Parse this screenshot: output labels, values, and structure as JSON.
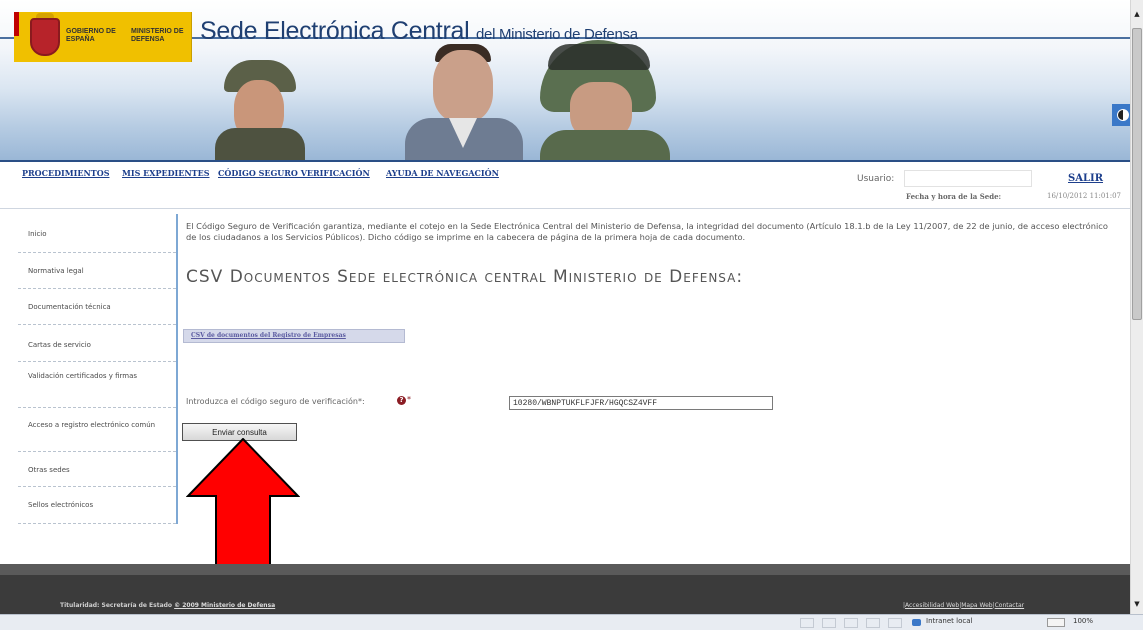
{
  "header": {
    "logo_gobierno": "GOBIERNO DE ESPAÑA",
    "logo_ministerio": "MINISTERIO DE DEFENSA",
    "site_title_main": "Sede Electrónica Central",
    "site_title_sub": "del Ministerio de Defensa",
    "contrast_icon": "contrast-icon"
  },
  "nav": {
    "procedimientos": "PROCEDIMIENTOS",
    "mis_expedientes": "MIS EXPEDIENTES",
    "codigo_seguro": "CÓDIGO SEGURO VERIFICACIÓN",
    "ayuda": "AYUDA DE NAVEGACIÓN",
    "usuario_label": "Usuario: ",
    "usuario_value": "",
    "salir": "SALIR",
    "fecha_label": "Fecha y hora de la Sede:",
    "fecha_value": "16/10/2012 11:01:07"
  },
  "sidebar": {
    "items": [
      {
        "label": "Inicio"
      },
      {
        "label": "Normativa legal"
      },
      {
        "label": "Documentación técnica"
      },
      {
        "label": "Cartas de servicio"
      },
      {
        "label": "Validación certificados y firmas"
      },
      {
        "label": "Acceso a registro electrónico común"
      },
      {
        "label": "Otras sedes"
      },
      {
        "label": "Sellos electrónicos"
      }
    ]
  },
  "main": {
    "intro": "El Código Seguro de Verificación garantiza, mediante el cotejo en la Sede Electrónica Central del Ministerio de Defensa, la integridad del documento (Artículo 18.1.b de la Ley 11/2007, de 22 de junio, de acceso electrónico de los ciudadanos a los Servicios Públicos). Dicho código se imprime en la cabecera de página de la primera hoja de cada documento.",
    "heading": "CSV Documentos Sede electrónica central Ministerio de Defensa:",
    "registro_tab": "CSV de documentos del Registro de Empresas",
    "csv_label": "Introduzca el código seguro de verificación*:",
    "csv_value": "10280/WBNPTUKFLFJFR/HGQCSZ4VFF",
    "submit": "Enviar consulta",
    "help_icon": "help-icon"
  },
  "footer": {
    "titularidad": "Titularidad: Secretaría de Estado",
    "copyright": "© 2009 Ministerio de Defensa",
    "accesibilidad": "Accesibilidad Web",
    "mapa": "Mapa Web",
    "contactar": "Contactar"
  },
  "statusbar": {
    "zone": "Intranet local",
    "zoom": "100%"
  },
  "annotation": {
    "arrow_color": "#ff0000"
  }
}
